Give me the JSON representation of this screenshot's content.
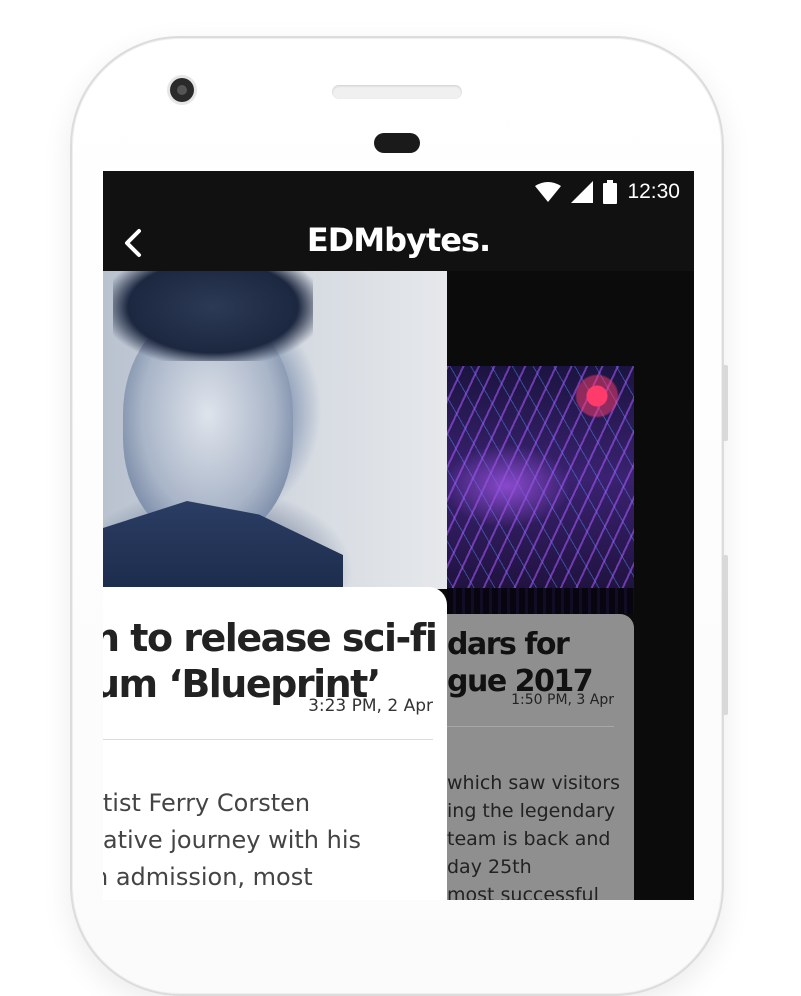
{
  "status_bar": {
    "time": "12:30",
    "icons": [
      "wifi-icon",
      "signal-icon",
      "battery-icon"
    ]
  },
  "app_bar": {
    "title": "EDMbytes.",
    "back_icon": "chevron-left-icon"
  },
  "articles": [
    {
      "headline_lines": [
        "n to release sci-fi",
        "um ‘Blueprint’"
      ],
      "time": "3:23 PM, 2 Apr",
      "excerpt_lines": [
        "rtist Ferry Corsten",
        "rative journey with his",
        "n admission, most"
      ]
    },
    {
      "headline_lines": [
        "dars for",
        "gue 2017"
      ],
      "time": "1:50 PM, 3 Apr",
      "excerpt_lines": [
        "which saw visitors",
        "ing the legendary",
        "team is back and",
        "day 25th",
        "most successful"
      ]
    }
  ],
  "colors": {
    "bar_background": "#111111",
    "screen_background": "#0b0b0b",
    "card_primary": "#ffffff",
    "card_secondary": "#8f8f8f"
  }
}
